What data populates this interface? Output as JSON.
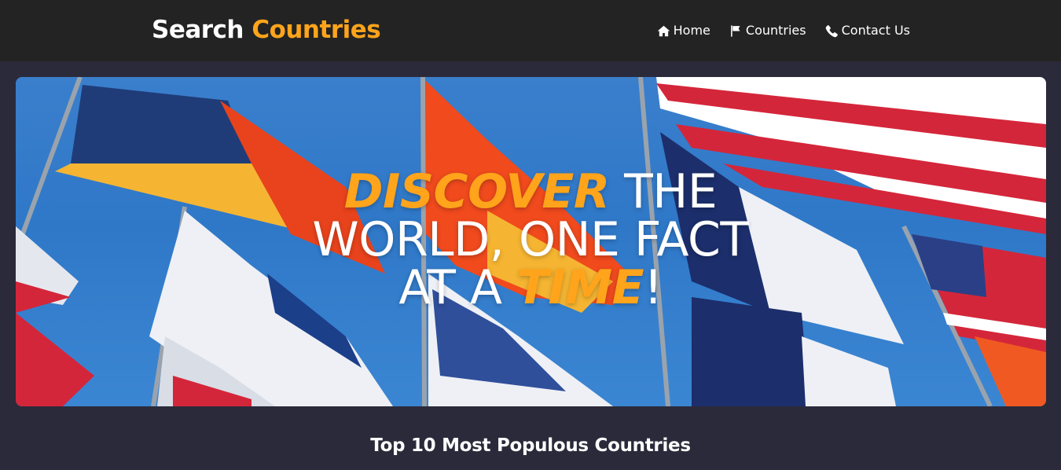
{
  "header": {
    "brand_part1": "Search",
    "brand_part2": "Countries",
    "nav": [
      {
        "label": "Home",
        "icon": "home-icon"
      },
      {
        "label": "Countries",
        "icon": "flag-icon"
      },
      {
        "label": "Contact Us",
        "icon": "phone-icon"
      }
    ]
  },
  "hero": {
    "word_discover": "DISCOVER",
    "text_the": " THE",
    "text_world": "WORLD, ONE FACT",
    "text_at_a": "AT A ",
    "word_time": "TIME",
    "text_bang": "!"
  },
  "main": {
    "section_title": "Top 10 Most Populous Countries"
  },
  "colors": {
    "accent": "#ffa41b",
    "navbar_bg": "#232323",
    "page_bg": "#2b2a3a"
  }
}
